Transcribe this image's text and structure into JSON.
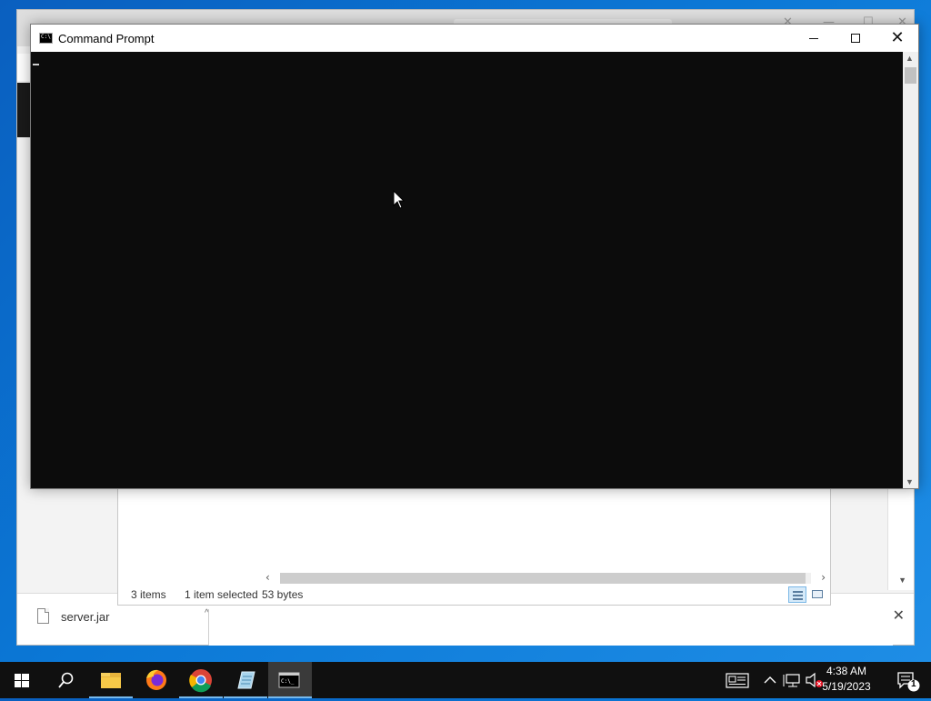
{
  "colors": {
    "desktop": "#0b78d6",
    "console_bg": "#0c0c0c",
    "taskbar": "#101010",
    "accent": "#76b9ed"
  },
  "cmd_window": {
    "title": "Command Prompt",
    "icon": "cmd-icon",
    "icon_glyph": "C:\\",
    "close_glyph": "✕"
  },
  "explorer": {
    "status": {
      "items": "3 items",
      "selected": "1 item selected",
      "size": "53 bytes"
    },
    "scroll_left": "‹",
    "scroll_right": "›"
  },
  "download_bar": {
    "file_name": "server.jar",
    "caret": "^",
    "close_glyph": "✕"
  },
  "taskbar": {
    "apps": [
      "start-windows-icon",
      "search-icon",
      "file-explorer-icon",
      "firefox-icon",
      "chrome-icon",
      "notepad-icon",
      "command-prompt-icon"
    ],
    "time": "4:38 AM",
    "date": "5/19/2023",
    "notification_count": "1"
  }
}
